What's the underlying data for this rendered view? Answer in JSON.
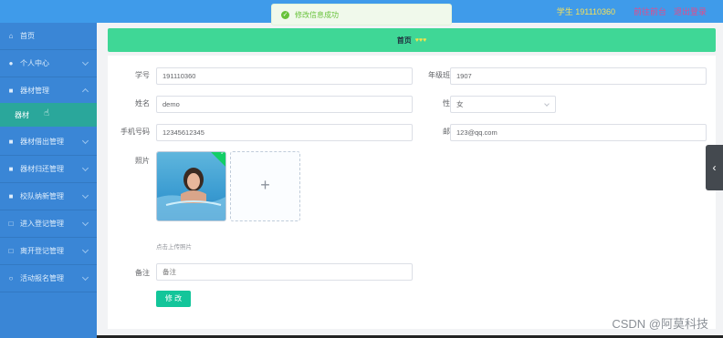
{
  "topbar": {
    "user": "学生 191110360",
    "link_front": "前往前台",
    "link_logout": "退出登录"
  },
  "toast": {
    "message": "修改信息成功"
  },
  "sidebar": {
    "items": [
      {
        "label": "首页",
        "icon": "home-icon"
      },
      {
        "label": "个人中心",
        "icon": "user-icon"
      },
      {
        "label": "器材管理",
        "icon": "box-icon"
      },
      {
        "label": "器材借出管理",
        "icon": "box-icon"
      },
      {
        "label": "器材归还管理",
        "icon": "box-icon"
      },
      {
        "label": "校队纳新管理",
        "icon": "box-icon"
      },
      {
        "label": "进入登记管理",
        "icon": "box-icon"
      },
      {
        "label": "离开登记管理",
        "icon": "box-icon"
      },
      {
        "label": "活动报名管理",
        "icon": "box-icon"
      }
    ],
    "sub_item": "器材"
  },
  "breadcrumb": {
    "home": "首页",
    "hearts": "♥♥♥"
  },
  "form": {
    "student_no_label": "学号",
    "student_no_value": "191110360",
    "grade_label": "年级班级",
    "grade_value": "1907",
    "name_label": "姓名",
    "name_value": "demo",
    "gender_label": "性别",
    "gender_value": "女",
    "phone_label": "手机号码",
    "phone_value": "12345612345",
    "email_label": "邮箱",
    "email_value": "123@qq.com",
    "photo_label": "照片",
    "upload_tip": "点击上传照片",
    "remark_label": "备注",
    "remark_placeholder": "备注",
    "submit_label": "修 改"
  },
  "watermark": "CSDN @阿莫科技"
}
